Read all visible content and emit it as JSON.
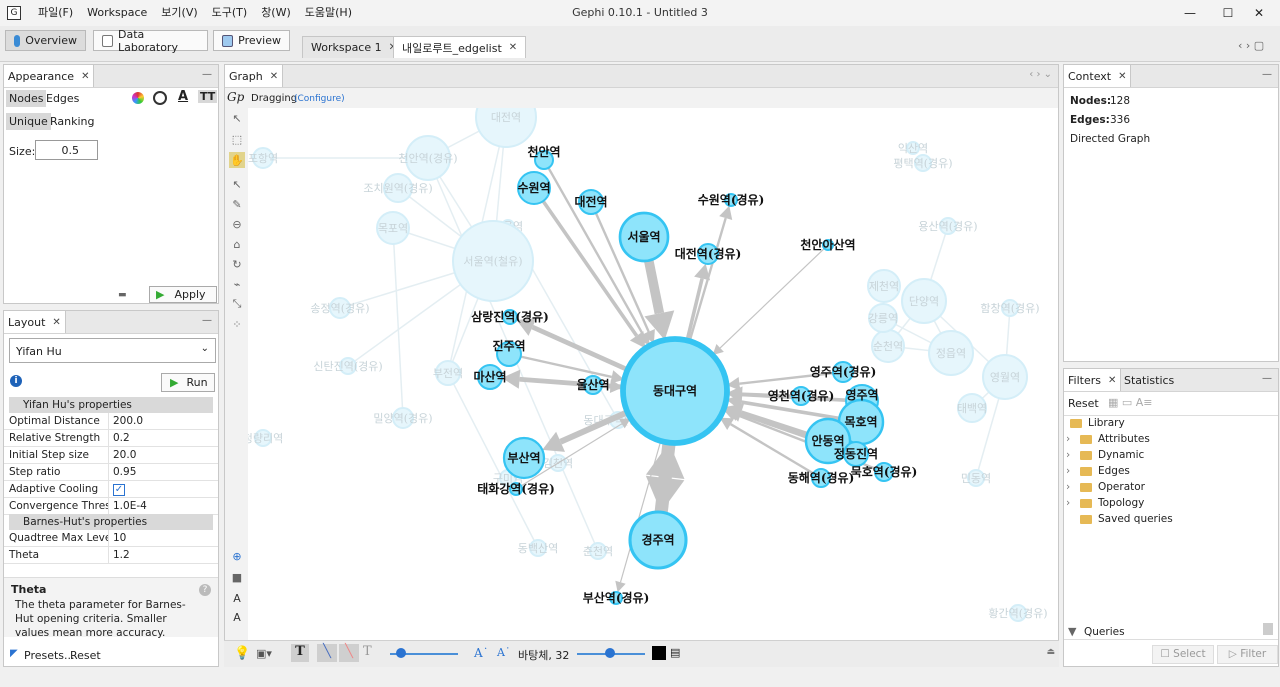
{
  "menu": {
    "items": [
      "파일(F)",
      "Workspace",
      "보기(V)",
      "도구(T)",
      "창(W)",
      "도움말(H)"
    ]
  },
  "window": {
    "title": "Gephi 0.10.1 - Untitled 3",
    "min": "—",
    "max": "☐",
    "close": "✕"
  },
  "toolbar": {
    "overview": "Overview",
    "data_lab": "Data Laboratory",
    "preview": "Preview"
  },
  "doc_tabs": {
    "workspace": "Workspace 1",
    "file": "내일로루트_edgelist",
    "nav": "‹  ›  ▢"
  },
  "appearance": {
    "title": "Appearance",
    "nodes": "Nodes",
    "edges": "Edges",
    "unique": "Unique",
    "ranking": "Ranking",
    "size_label": "Size:",
    "size_value": "0.5",
    "apply": "Apply",
    "text_icon": "A",
    "tt_icon": "TT"
  },
  "layout": {
    "title": "Layout",
    "algorithm": "Yifan Hu",
    "run": "Run",
    "props_header": "Yifan Hu's properties",
    "props": [
      {
        "k": "Optimal Distance",
        "v": "200.0"
      },
      {
        "k": "Relative Strength",
        "v": "0.2"
      },
      {
        "k": "Initial Step size",
        "v": "20.0"
      },
      {
        "k": "Step ratio",
        "v": "0.95"
      },
      {
        "k": "Adaptive Cooling",
        "v": "✓"
      },
      {
        "k": "Convergence Threshold",
        "v": "1.0E-4"
      }
    ],
    "bh_header": "Barnes-Hut's properties",
    "bh_props": [
      {
        "k": "Quadtree Max Level",
        "v": "10"
      },
      {
        "k": "Theta",
        "v": "1.2"
      }
    ],
    "desc_title": "Theta",
    "desc_text": "The theta parameter for Barnes-Hut opening criteria. Smaller values mean more accuracy.",
    "presets": "Presets...",
    "reset": "Reset"
  },
  "graph": {
    "title": "Graph",
    "mode": "Dragging",
    "configure": "(Configure)",
    "logo": "Gp",
    "font_label": "바탕체, 32",
    "text_tool": "T",
    "nodes": [
      {
        "label": "동대구역"
      },
      {
        "label": "서울역"
      },
      {
        "label": "경주역"
      },
      {
        "label": "부산역"
      },
      {
        "label": "수원역"
      },
      {
        "label": "천안역"
      },
      {
        "label": "대전역"
      },
      {
        "label": "수원역(경유)"
      },
      {
        "label": "대전역(경유)"
      },
      {
        "label": "천안아산역"
      },
      {
        "label": "삼랑진역(경유)"
      },
      {
        "label": "진주역"
      },
      {
        "label": "마산역"
      },
      {
        "label": "울산역"
      },
      {
        "label": "태화강역(경유)"
      },
      {
        "label": "부산역(경유)"
      },
      {
        "label": "영주역(경유)"
      },
      {
        "label": "영천역(경유)"
      },
      {
        "label": "영주역"
      },
      {
        "label": "목호역"
      },
      {
        "label": "안동역"
      },
      {
        "label": "정동진역"
      },
      {
        "label": "동해역(경유)"
      },
      {
        "label": "묵호역(경유)"
      }
    ],
    "faded_labels": [
      "대전역",
      "서울역",
      "천안역(경유)",
      "조치원역(경유)",
      "서울역(철유)",
      "목포역",
      "송정역(경유)",
      "순천역",
      "정읍역",
      "강릉역",
      "제천역",
      "영월역",
      "단양역",
      "태백역",
      "신탄진역(경유)",
      "부전역",
      "포항역",
      "밀양역(경유)",
      "구미역",
      "김천역",
      "동대구역(경유)",
      "평택역(경유)",
      "용산역(경유)",
      "함창역(경유)",
      "춘천역",
      "동백산역",
      "민동역",
      "황간역(경유)",
      "익산역",
      "청량리역"
    ]
  },
  "context": {
    "title": "Context",
    "nodes_label": "Nodes:",
    "nodes_value": "128",
    "edges_label": "Edges:",
    "edges_value": "336",
    "graph_type": "Directed Graph"
  },
  "filters": {
    "title": "Filters",
    "statistics": "Statistics",
    "reset": "Reset",
    "library": "Library",
    "items": [
      "Attributes",
      "Dynamic",
      "Edges",
      "Operator",
      "Topology"
    ],
    "saved": "Saved queries",
    "queries": "Queries",
    "select": "Select",
    "filter": "Filter"
  },
  "colors": {
    "node": "#8ee4fb",
    "node_stroke": "#35c4f2",
    "edge": "#c4c4c4",
    "accent": "#2a73d1"
  }
}
